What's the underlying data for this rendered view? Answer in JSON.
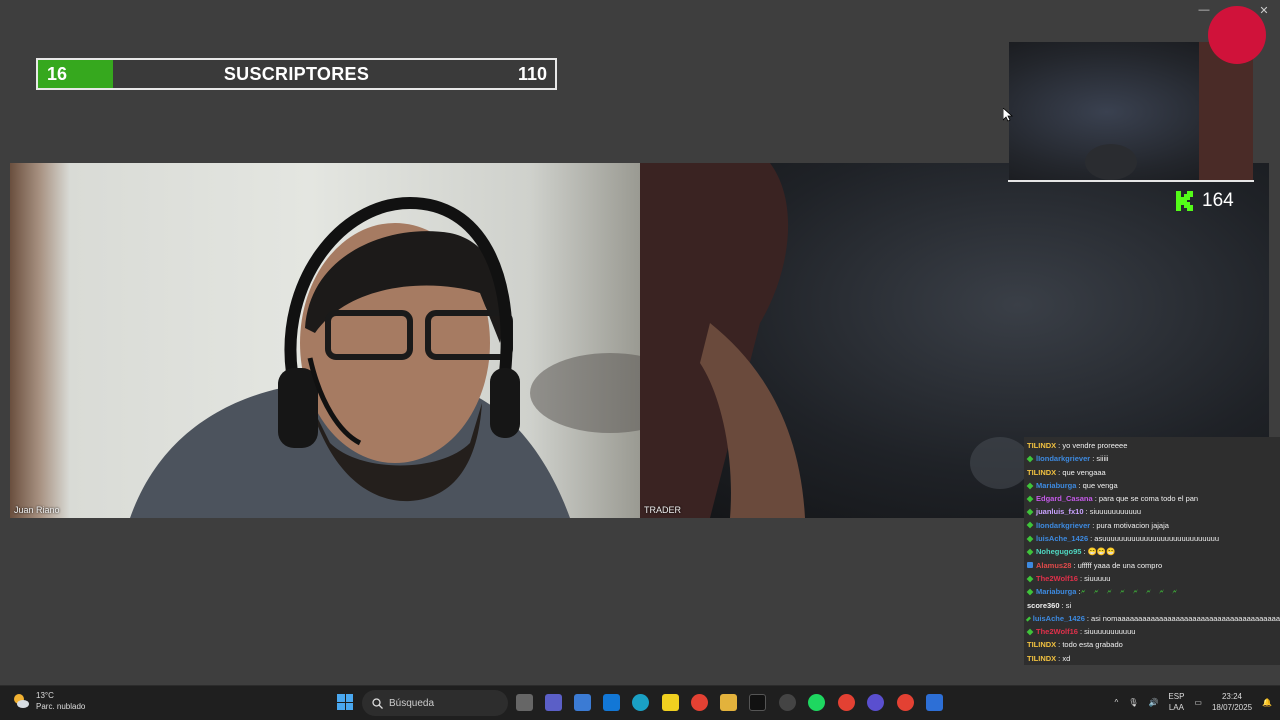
{
  "window": {
    "minimize": "—",
    "maximize": "▢",
    "close": "✕"
  },
  "goal": {
    "current": "16",
    "label": "SUSCRIPTORES",
    "target": "110",
    "progress_fraction": 0.1455,
    "fill_color": "#36a81e"
  },
  "cameras": {
    "left_label": "Juan Riano",
    "right_label": "TRADER"
  },
  "overlay": {
    "kick_count": "164",
    "kick_color": "#53fc18",
    "rec_color": "#d0123a"
  },
  "chat": {
    "messages": [
      {
        "user": "TILINDX",
        "color": "#f0c040",
        "badge": "",
        "text": ": yo vendre proreeee"
      },
      {
        "user": "lIondarkgriever",
        "color": "#3d8ae0",
        "badge": "green",
        "text": ": siiiii"
      },
      {
        "user": "TILINDX",
        "color": "#f0c040",
        "badge": "",
        "text": ": que vengaaa"
      },
      {
        "user": "Mariaburga",
        "color": "#3d8ae0",
        "badge": "green",
        "text": ": que venga"
      },
      {
        "user": "Edgard_Casana",
        "color": "#c45ae8",
        "badge": "green",
        "text": ": para que se coma todo el pan"
      },
      {
        "user": "juanluis_fx10",
        "color": "#c9a2ff",
        "badge": "green",
        "text": ": siuuuuuuuuuuu"
      },
      {
        "user": "lIondarkgriever",
        "color": "#3d8ae0",
        "badge": "green",
        "text": ": pura motivacion jajaja"
      },
      {
        "user": "luisAche_1426",
        "color": "#3d8ae0",
        "badge": "green",
        "text": ": asuuuuuuuuuuuuuuuuuuuuuuuuuuuu"
      },
      {
        "user": "Nohegugo95",
        "color": "#4fd6c0",
        "badge": "green",
        "text": ": 😁😁😁"
      },
      {
        "user": "Alamus28",
        "color": "#e04a4a",
        "badge": "blue",
        "text": ": ufffff yaaa de una compro"
      },
      {
        "user": "The2Wolf16",
        "color": "#e0304a",
        "badge": "green",
        "text": ": siuuuuu"
      },
      {
        "user": "Mariaburga",
        "color": "#3d8ae0",
        "badge": "green",
        "text": ":",
        "emote": "🗲 🗲 🗲 🗲 🗲 🗲 🗲 🗲"
      },
      {
        "user": "score360",
        "color": "#f0f0f0",
        "badge": "",
        "text": ": si"
      },
      {
        "user": "luisAche_1426",
        "color": "#3d8ae0",
        "badge": "green",
        "text": ": asi nomaaaaaaaaaaaaaaaaaaaaaaaaaaaaaaaaaaaaaaa"
      },
      {
        "user": "The2Wolf16",
        "color": "#e0304a",
        "badge": "green",
        "text": ": siuuuuuuuuuuu"
      },
      {
        "user": "TILINDX",
        "color": "#f0c040",
        "badge": "",
        "text": ": todo esta grabado"
      },
      {
        "user": "TILINDX",
        "color": "#f0c040",
        "badge": "",
        "text": ": xd"
      }
    ]
  },
  "taskbar": {
    "weather_temp": "13°C",
    "weather_desc": "Parc. nublado",
    "search_placeholder": "Búsqueda",
    "lang_top": "ESP",
    "lang_bottom": "LAA",
    "time": "23:24",
    "date": "18/07/2025"
  }
}
